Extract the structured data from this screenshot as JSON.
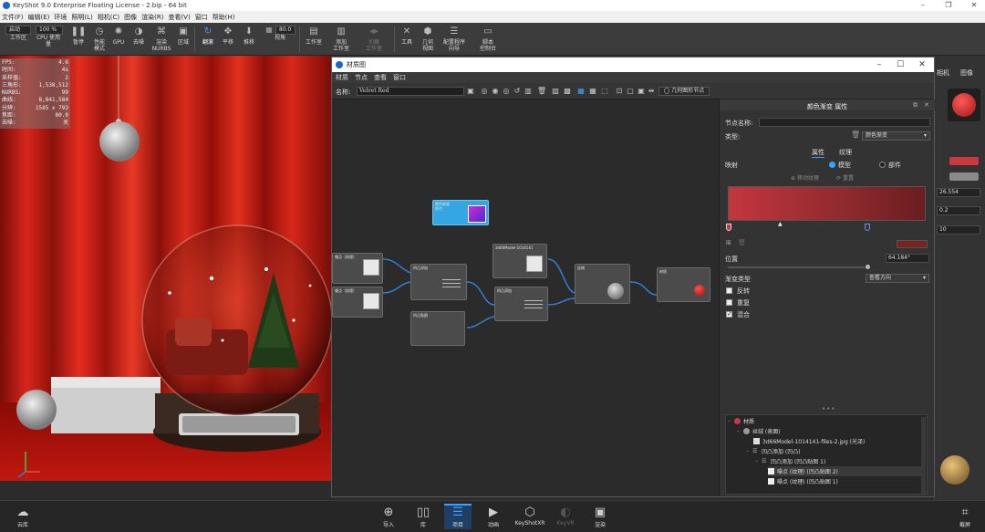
{
  "window": {
    "title": "KeyShot 9.0 Enterprise Floating License - 2.bip - 64 bit"
  },
  "menu": [
    "文件(F)",
    "编辑(E)",
    "环境",
    "照明(L)",
    "相机(C)",
    "图像",
    "渲染(R)",
    "查看(V)",
    "窗口",
    "帮助(H)"
  ],
  "toolbar": {
    "mode_value": "启动",
    "zoom_value": "100 %",
    "fov_value": "80.0",
    "buttons": [
      {
        "label": "工作区",
        "icon": "workspace-icon"
      },
      {
        "label": "CPU 使用量",
        "icon": "cpu-icon"
      },
      {
        "label": "暂停",
        "icon": "pause-icon"
      },
      {
        "label": "性能\n模式",
        "icon": "performance-icon"
      },
      {
        "label": "GPU",
        "icon": "gpu-icon"
      },
      {
        "label": "去噪",
        "icon": "denoise-icon"
      },
      {
        "label": "渲染\nNURBS",
        "icon": "nurbs-icon"
      },
      {
        "label": "区域",
        "icon": "region-icon"
      },
      {
        "label": "翻滚",
        "icon": "tumble-icon"
      },
      {
        "label": "平移",
        "icon": "pan-icon"
      },
      {
        "label": "推移",
        "icon": "dolly-icon"
      },
      {
        "label": "视角",
        "icon": "view-icon"
      },
      {
        "label": "工作室",
        "icon": "studio-icon"
      },
      {
        "label": "添加\n工作室",
        "icon": "add-studio-icon"
      },
      {
        "label": "切换\n工作室",
        "icon": "switch-studio-icon"
      },
      {
        "label": "工具",
        "icon": "tools-icon"
      },
      {
        "label": "几何\n视图",
        "icon": "geometry-view-icon"
      },
      {
        "label": "配置程序\n向导",
        "icon": "configurator-icon"
      },
      {
        "label": "脚本\n控制台",
        "icon": "script-console-icon"
      }
    ]
  },
  "stats": [
    {
      "k": "FPS:",
      "v": "4.6"
    },
    {
      "k": "时间:",
      "v": "4s"
    },
    {
      "k": "采样值:",
      "v": "2"
    },
    {
      "k": "三角形:",
      "v": "1,538,512"
    },
    {
      "k": "NURBS:",
      "v": "99"
    },
    {
      "k": "曲线:",
      "v": "8,841,584"
    },
    {
      "k": "分辨:",
      "v": "1585 x 793"
    },
    {
      "k": "焦距:",
      "v": "80.0"
    },
    {
      "k": "去噪:",
      "v": "关"
    }
  ],
  "right_panel": {
    "tabs": [
      "相机",
      "图像"
    ],
    "value1": "26.554",
    "value2": "0.2",
    "value3": "10",
    "swatch_color": "#c9393f"
  },
  "material_window": {
    "title": "材质图",
    "menu": [
      "材质",
      "节点",
      "查看",
      "窗口"
    ],
    "name_label": "名称:",
    "name_value": "Velvet Red",
    "geometry_button": "几何图形节点",
    "nodes": [
      {
        "id": "color-gradient",
        "title": "颜色渐变",
        "sub": "颜色"
      },
      {
        "id": "noise1",
        "title": "噪点（纹理）"
      },
      {
        "id": "noise2",
        "title": "噪点（纹理）"
      },
      {
        "id": "bump-add1",
        "title": "凹凸添加"
      },
      {
        "id": "bump-add2",
        "title": "凹凸添加"
      },
      {
        "id": "texture-map1",
        "title": "3d66Model-1014141"
      },
      {
        "id": "texture-map2",
        "title": "凹凸贴图"
      },
      {
        "id": "fabric",
        "title": "丝绒"
      },
      {
        "id": "material",
        "title": "材质"
      }
    ],
    "properties": {
      "header": "颜色渐变 属性",
      "node_name_label": "节点名称:",
      "type_label": "类型:",
      "type_value": "颜色渐变",
      "tab_properties": "属性",
      "tab_texture": "纹理",
      "mapping_label": "映射",
      "radio_model": "模型",
      "radio_part": "部件",
      "move_texture_btn": "移动纹理",
      "reset_btn": "重置",
      "position_label": "位置",
      "position_value": "64.184°",
      "gradient_type_label": "渐变类型",
      "gradient_type_value": "查看方向",
      "checkboxes": [
        {
          "label": "反转",
          "checked": false
        },
        {
          "label": "重复",
          "checked": false
        },
        {
          "label": "混合",
          "checked": true
        }
      ],
      "gradient_colors": [
        "#c3363d",
        "#8e2a2e",
        "#6a1d20"
      ],
      "stop_color": "#7a2222"
    },
    "tree": [
      {
        "label": "材质",
        "level": 0
      },
      {
        "label": "丝绒 (表面)",
        "level": 1
      },
      {
        "label": "3d66Model-1014141-files-2.jpg (光泽)",
        "level": 2
      },
      {
        "label": "凹凸添加 (凹凸)",
        "level": 2
      },
      {
        "label": "凹凸添加 (凹凸贴图 1)",
        "level": 3
      },
      {
        "label": "噪点 (纹理) (凹凸贴图 2)",
        "level": 4
      },
      {
        "label": "噪点 (纹理) (凹凸贴图 1)",
        "level": 4
      }
    ]
  },
  "bottom_bar": {
    "left": "云库",
    "right": "截屏",
    "buttons": [
      {
        "label": "导入",
        "icon": "import-icon"
      },
      {
        "label": "库",
        "icon": "library-icon"
      },
      {
        "label": "项目",
        "icon": "project-icon",
        "active": true
      },
      {
        "label": "动画",
        "icon": "animation-icon"
      },
      {
        "label": "KeyShotXR",
        "icon": "keyshotxr-icon"
      },
      {
        "label": "KeyVR",
        "icon": "keyvr-icon",
        "dim": true
      },
      {
        "label": "渲染",
        "icon": "render-icon"
      }
    ]
  }
}
